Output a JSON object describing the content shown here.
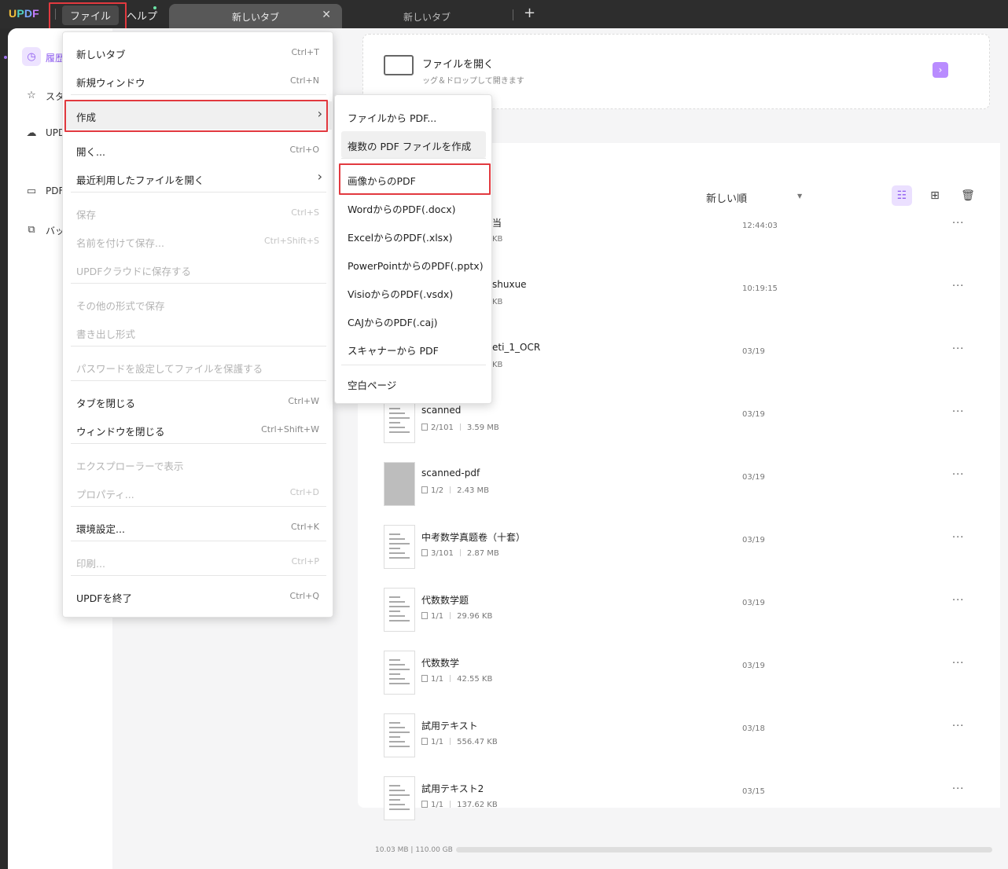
{
  "app": {
    "logo": [
      "U",
      "P",
      "D",
      "F"
    ],
    "menubar": {
      "file": "ファイル",
      "help": "ヘルプ"
    },
    "tabs": [
      {
        "label": "新しいタブ",
        "active": true
      },
      {
        "label": "新しいタブ",
        "active": false
      }
    ],
    "new_tab_symbol": "+"
  },
  "sidebar": {
    "items": [
      {
        "label": "履歴",
        "icon": "clock-icon",
        "active": true
      },
      {
        "label": "スター",
        "icon": "star-icon",
        "active": false
      },
      {
        "label": "UPDF",
        "icon": "cloud-icon",
        "active": false
      },
      {
        "label": "PDF",
        "icon": "briefcase-icon",
        "active": false
      },
      {
        "label": "バッチ",
        "icon": "copy-icon",
        "active": false
      }
    ]
  },
  "open_card": {
    "title": "ファイルを開く",
    "subtitle": "ッグ＆ドロップして開きます"
  },
  "list": {
    "sort_label": "新しい順",
    "files": [
      {
        "name": "当",
        "pages": "",
        "size": "KB",
        "date": "12:44:03"
      },
      {
        "name": "shuxue",
        "pages": "",
        "size": "KB",
        "date": "10:19:15"
      },
      {
        "name": "eti_1_OCR",
        "pages": "",
        "size": "KB",
        "date": "03/19"
      },
      {
        "name": "scanned",
        "pages": "2/101",
        "size": "3.59 MB",
        "date": "03/19"
      },
      {
        "name": "scanned-pdf",
        "pages": "1/2",
        "size": "2.43 MB",
        "date": "03/19"
      },
      {
        "name": "中考数学真题卷（十套）",
        "pages": "3/101",
        "size": "2.87 MB",
        "date": "03/19"
      },
      {
        "name": "代数数学题",
        "pages": "1/1",
        "size": "29.96 KB",
        "date": "03/19"
      },
      {
        "name": "代数数学",
        "pages": "1/1",
        "size": "42.55 KB",
        "date": "03/19"
      },
      {
        "name": "試用テキスト",
        "pages": "1/1",
        "size": "556.47 KB",
        "date": "03/18"
      },
      {
        "name": "試用テキスト2",
        "pages": "1/1",
        "size": "137.62 KB",
        "date": "03/15"
      }
    ],
    "more_symbol": "···"
  },
  "storage": {
    "text": "10.03 MB | 110.00 GB",
    "used_fraction": 0.0001
  },
  "file_menu": {
    "items": [
      {
        "label": "新しいタブ",
        "shortcut": "Ctrl+T",
        "disabled": false
      },
      {
        "label": "新規ウィンドウ",
        "shortcut": "Ctrl+N",
        "disabled": false
      },
      {
        "label": "作成",
        "shortcut": "",
        "disabled": false,
        "submenu": true
      },
      {
        "label": "開く...",
        "shortcut": "Ctrl+O",
        "disabled": false
      },
      {
        "label": "最近利用したファイルを開く",
        "shortcut": "",
        "disabled": false,
        "submenu": true
      },
      {
        "label": "保存",
        "shortcut": "Ctrl+S",
        "disabled": true
      },
      {
        "label": "名前を付けて保存...",
        "shortcut": "Ctrl+Shift+S",
        "disabled": true
      },
      {
        "label": "UPDFクラウドに保存する",
        "shortcut": "",
        "disabled": true
      },
      {
        "label": "その他の形式で保存",
        "shortcut": "",
        "disabled": true
      },
      {
        "label": "書き出し形式",
        "shortcut": "",
        "disabled": true
      },
      {
        "label": "パスワードを設定してファイルを保護する",
        "shortcut": "",
        "disabled": true
      },
      {
        "label": "タブを閉じる",
        "shortcut": "Ctrl+W",
        "disabled": false
      },
      {
        "label": "ウィンドウを閉じる",
        "shortcut": "Ctrl+Shift+W",
        "disabled": false
      },
      {
        "label": "エクスプローラーで表示",
        "shortcut": "",
        "disabled": true
      },
      {
        "label": "プロパティ...",
        "shortcut": "Ctrl+D",
        "disabled": true
      },
      {
        "label": "環境設定...",
        "shortcut": "Ctrl+K",
        "disabled": false
      },
      {
        "label": "印刷...",
        "shortcut": "Ctrl+P",
        "disabled": true
      },
      {
        "label": "UPDFを終了",
        "shortcut": "Ctrl+Q",
        "disabled": false
      }
    ]
  },
  "create_submenu": {
    "items": [
      {
        "label": "ファイルから PDF..."
      },
      {
        "label": "複数の PDF ファイルを作成"
      },
      {
        "label": "画像からのPDF"
      },
      {
        "label": "WordからのPDF(.docx)"
      },
      {
        "label": "ExcelからのPDF(.xlsx)"
      },
      {
        "label": "PowerPointからのPDF(.pptx)"
      },
      {
        "label": "VisioからのPDF(.vsdx)"
      },
      {
        "label": "CAJからのPDF(.caj)"
      },
      {
        "label": "スキャナーから PDF"
      },
      {
        "label": "空白ページ"
      }
    ]
  },
  "colors": {
    "accent": "#8e5cf0",
    "highlight_box": "#e2393f",
    "titlebar": "#2d2d2d"
  }
}
